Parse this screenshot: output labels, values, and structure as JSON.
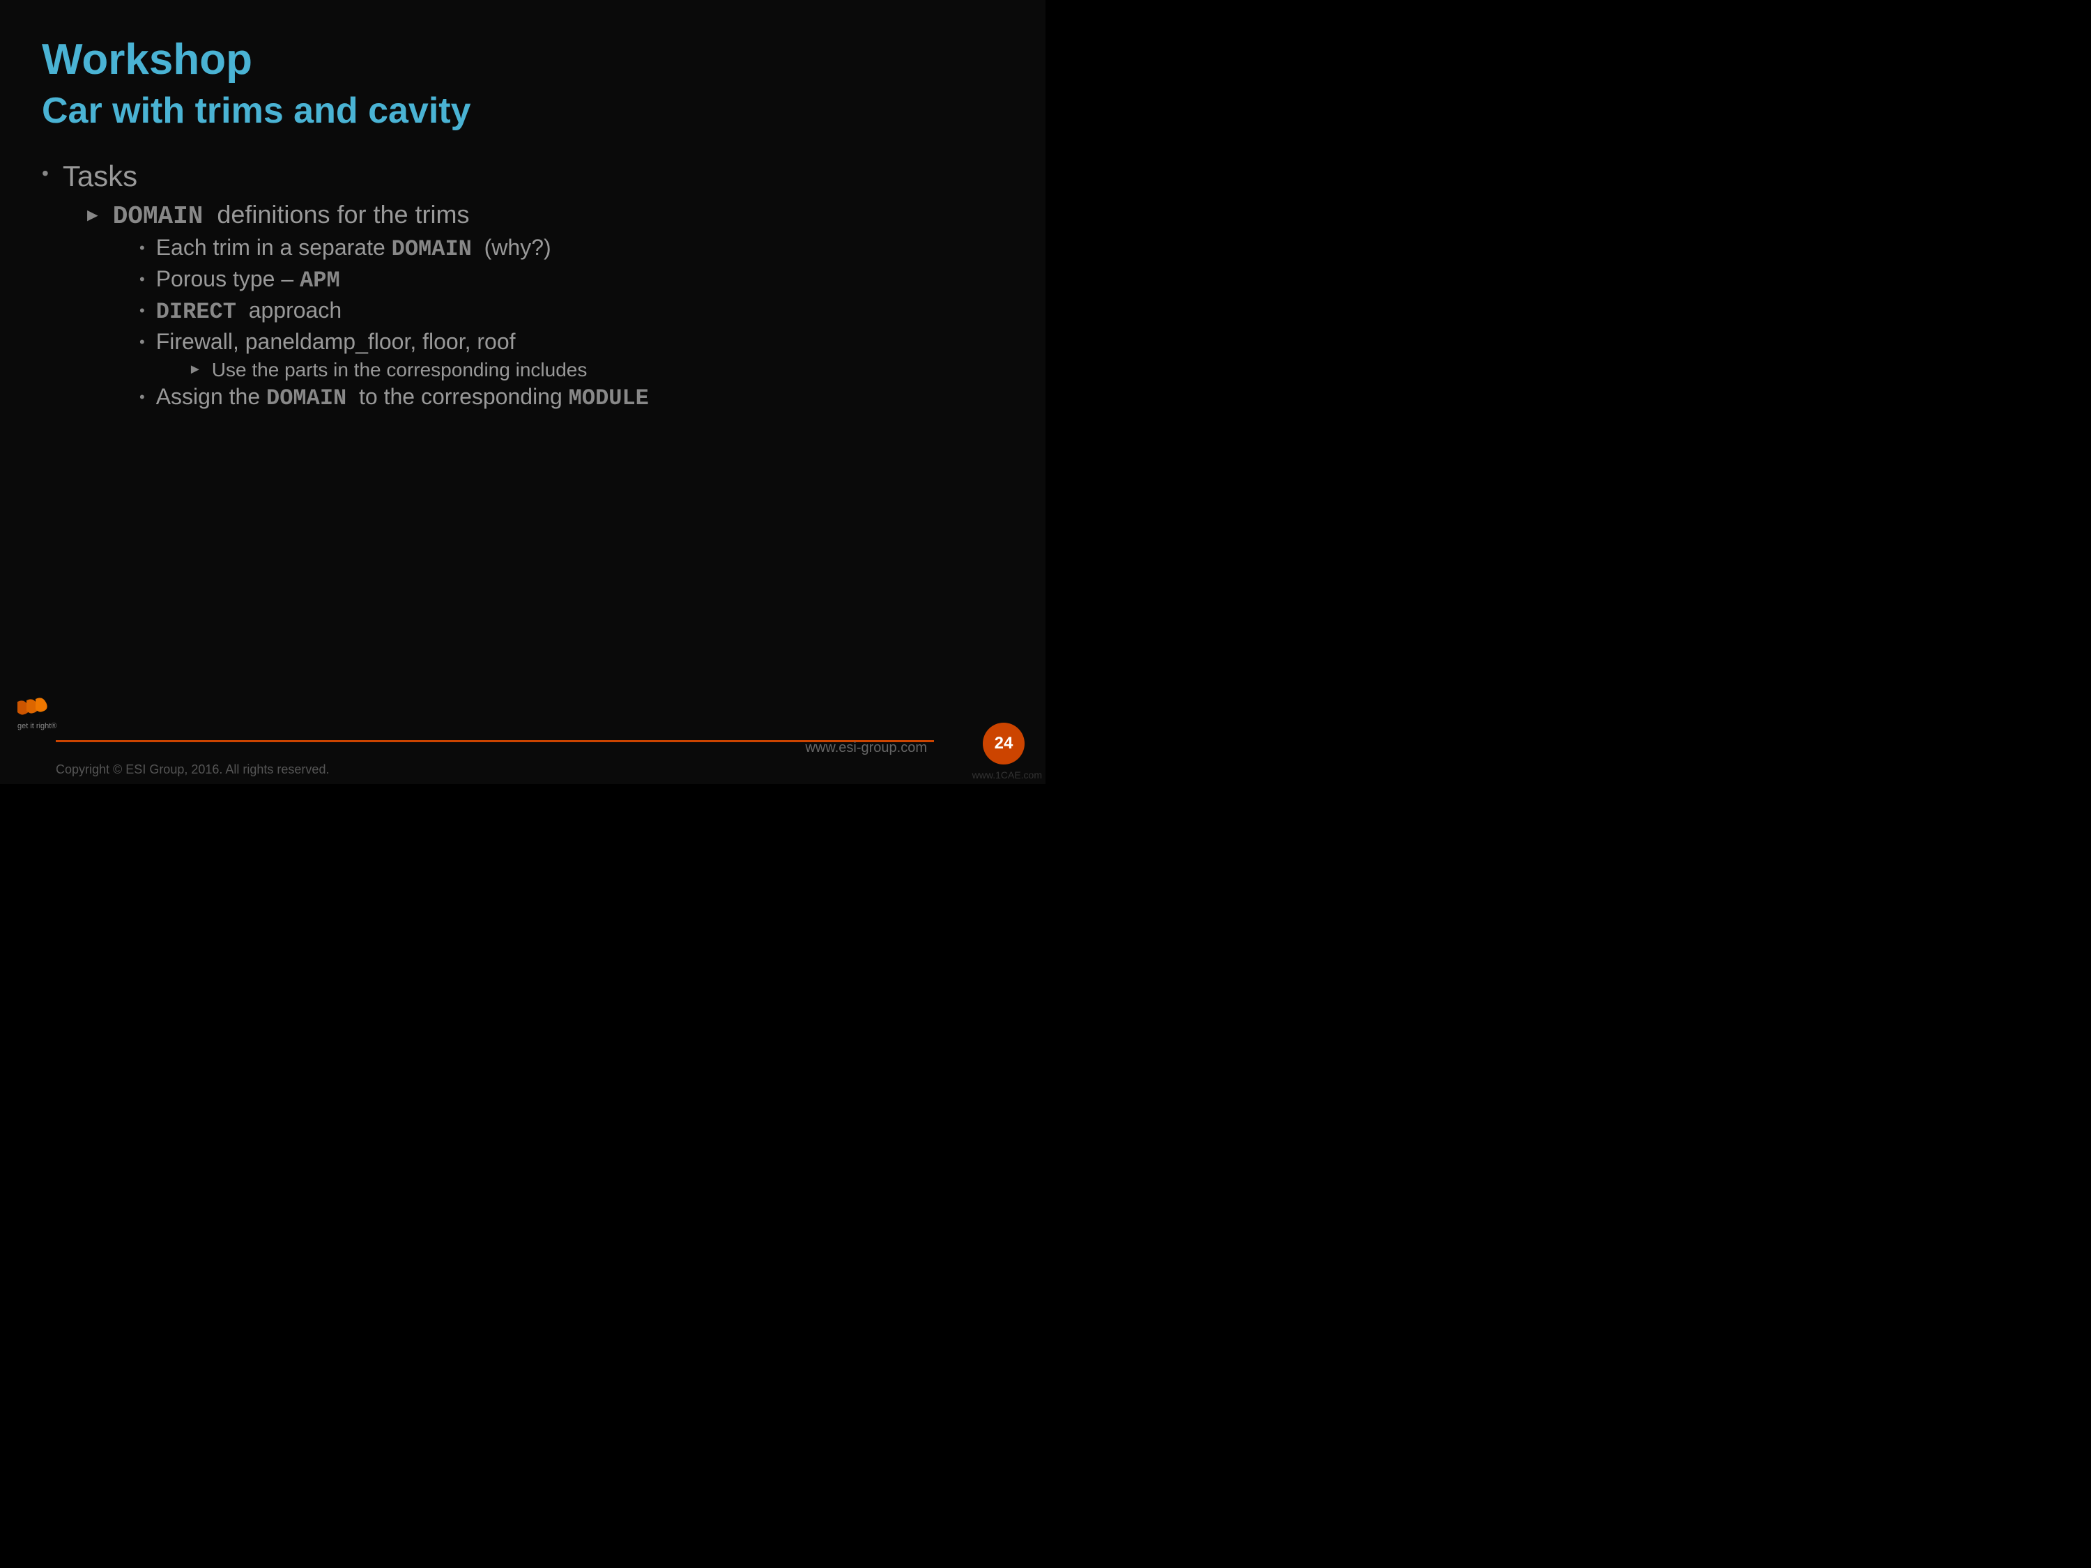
{
  "slide": {
    "title": "Workshop",
    "subtitle": "Car with trims and cavity",
    "tasks_label": "Tasks",
    "level2": {
      "item1_prefix": "DOMAIN",
      "item1_suffix": "  definitions for the trims"
    },
    "level3": [
      {
        "text_before": "Each trim in a separate ",
        "mono": "DOMAIN",
        "text_after": "  (why?)"
      },
      {
        "text_before": "Porous type – ",
        "mono": "APM",
        "text_after": ""
      },
      {
        "text_before": "",
        "mono": "DIRECT",
        "text_after": "  approach"
      },
      {
        "text_before": "Firewall, paneldamp_floor, floor, roof",
        "mono": "",
        "text_after": ""
      },
      {
        "text_before": "Assign the ",
        "mono": "DOMAIN",
        "text_after": "  to the corresponding ",
        "mono2": "MODULE"
      }
    ],
    "level4": [
      {
        "text": "Use the parts in the corresponding includes"
      }
    ],
    "footer": {
      "website": "www.esi-group.com",
      "page_number": "24",
      "copyright": "Copyright © ESI Group, 2016. All rights reserved."
    }
  }
}
